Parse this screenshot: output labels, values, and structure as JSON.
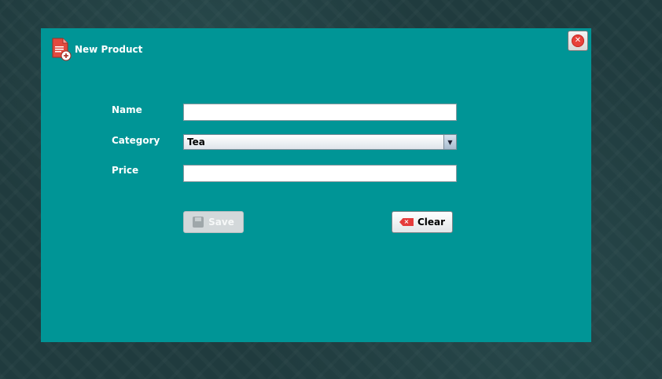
{
  "dialog": {
    "title": "New Product",
    "close_icon": "close-icon"
  },
  "form": {
    "name_label": "Name",
    "name_value": "",
    "category_label": "Category",
    "category_selected": "Tea",
    "price_label": "Price",
    "price_value": ""
  },
  "buttons": {
    "save_label": "Save",
    "clear_label": "Clear"
  },
  "colors": {
    "dialog_background": "#009596",
    "close_red": "#e8403a",
    "clear_icon_red": "#e53b3b"
  }
}
